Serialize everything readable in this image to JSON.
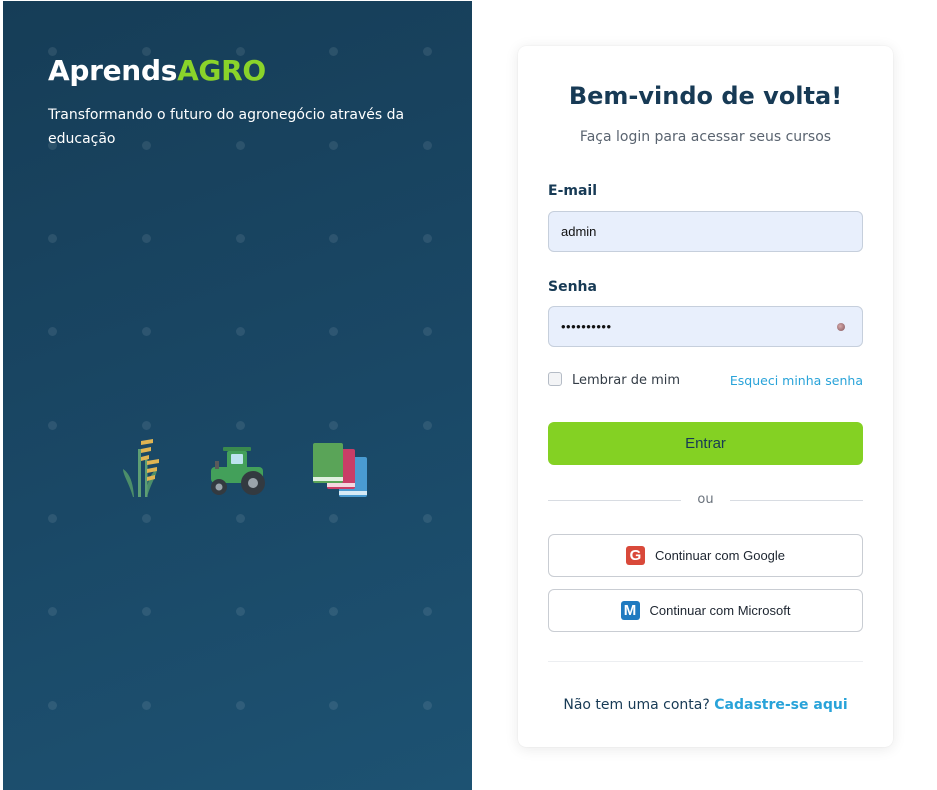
{
  "brand": {
    "name_main": "Aprends",
    "name_accent": "AGRO"
  },
  "hero": {
    "tagline": "Transformando o futuro do agronegócio através da educação",
    "icons": [
      "wheat-icon",
      "tractor-icon",
      "books-icon"
    ]
  },
  "login": {
    "title": "Bem-vindo de volta!",
    "subtitle": "Faça login para acessar seus cursos",
    "email_label": "E-mail",
    "email_value": "admin",
    "password_label": "Senha",
    "password_value": "••••••••••",
    "remember_label": "Lembrar de mim",
    "forgot_label": "Esqueci minha senha",
    "submit_label": "Entrar",
    "divider_text": "ou",
    "google_label": "Continuar com Google",
    "google_logo_letter": "G",
    "microsoft_label": "Continuar com Microsoft",
    "microsoft_logo_letter": "M",
    "signup_prompt": "Não tem uma conta?",
    "signup_link": "Cadastre-se aqui"
  },
  "colors": {
    "hero_bg": "#1a4866",
    "accent_green": "#8ad32a",
    "button_green": "#84d123",
    "link_blue": "#29a3d9",
    "title_navy": "#173a55",
    "google_red": "#d9493a",
    "microsoft_blue": "#1f7ac0"
  }
}
